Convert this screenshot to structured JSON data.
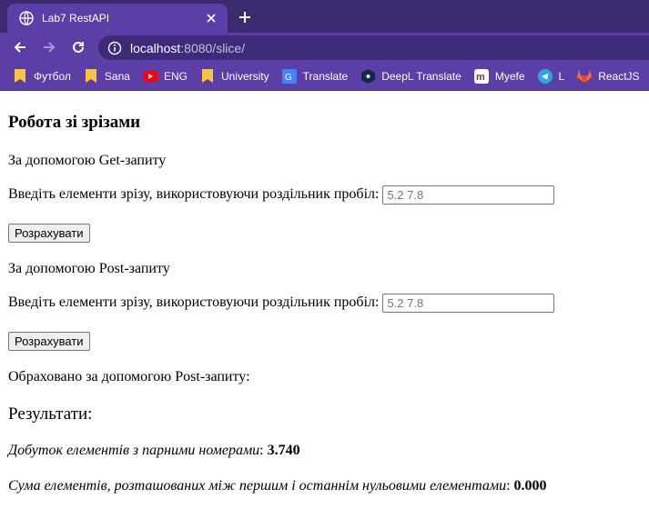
{
  "browser": {
    "tab_title": "Lab7 RestAPI",
    "url_host": "localhost",
    "url_rest": ":8080/slice/",
    "bookmarks": [
      {
        "label": "Футбол",
        "icon": "folder-icon",
        "color": "#f6c445"
      },
      {
        "label": "Sana",
        "icon": "folder-icon",
        "color": "#f6c445"
      },
      {
        "label": "ENG",
        "icon": "youtube-icon",
        "color": "#ff0000"
      },
      {
        "label": "University",
        "icon": "folder-icon",
        "color": "#f6c445"
      },
      {
        "label": "Translate",
        "icon": "google-translate-icon",
        "color": "#4285f4"
      },
      {
        "label": "DeepL Translate",
        "icon": "deepl-icon",
        "color": "#0f2b46"
      },
      {
        "label": "Myefe",
        "icon": "myefe-icon",
        "color": "#7a2c5c"
      },
      {
        "label": "L",
        "icon": "telegram-icon",
        "color": "#2ca5e0"
      },
      {
        "label": "ReactJS",
        "icon": "gitlab-icon",
        "color": "#fc6d26"
      }
    ]
  },
  "page": {
    "heading": "Робота зі зрізами",
    "get_section": {
      "caption": "За допомогою Get-запиту",
      "input_label": "Введіть елементи зрізу, використовуючи роздільник пробіл:",
      "input_placeholder": "5.2 7.8",
      "button_label": "Розрахувати"
    },
    "post_section": {
      "caption": "За допомогою Post-запиту",
      "input_label": "Введіть елементи зрізу, використовуючи роздільник пробіл:",
      "input_placeholder": "5.2 7.8",
      "button_label": "Розрахувати"
    },
    "status": "Обраховано за допомогою Post-запиту:",
    "results_heading": "Результати:",
    "results": [
      {
        "label": "Добуток елементів з парними номерами",
        "value": "3.740"
      },
      {
        "label": "Сума елементів, розташованих між першим і останнім нульовими елементами",
        "value": "0.000"
      }
    ]
  }
}
